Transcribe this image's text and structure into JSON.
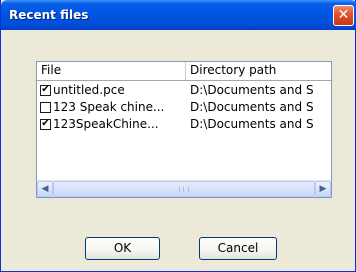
{
  "window": {
    "title": "Recent files",
    "close_glyph": "✕"
  },
  "list": {
    "columns": [
      "File",
      "Directory path"
    ],
    "rows": [
      {
        "checked": true,
        "file": "untitled.pce",
        "directory": "D:\\Documents and S"
      },
      {
        "checked": false,
        "file": "123 Speak chine...",
        "directory": "D:\\Documents and S"
      },
      {
        "checked": true,
        "file": "123SpeakChine...",
        "directory": "D:\\Documents and S"
      }
    ],
    "scroll_left_glyph": "◀",
    "scroll_right_glyph": "▶",
    "checkbox_checked_glyph": "✔"
  },
  "buttons": {
    "ok": "OK",
    "cancel": "Cancel"
  },
  "colors": {
    "titlebar": "#0054e3",
    "window_bg": "#ece9d8",
    "close_button": "#e0502c",
    "button_border": "#003c74"
  }
}
